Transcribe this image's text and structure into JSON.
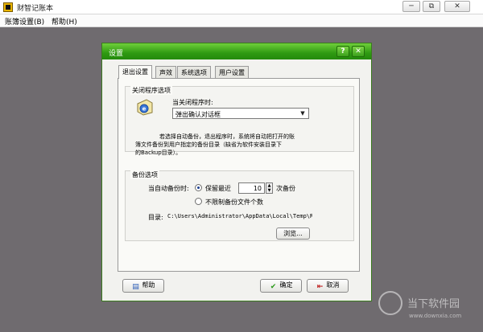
{
  "app": {
    "title": "财智记账本"
  },
  "window_controls": {
    "minimize": "─",
    "restore": "⧉",
    "close": "✕"
  },
  "menu": [
    {
      "label": "账簿设置(B)"
    },
    {
      "label": "帮助(H)"
    }
  ],
  "dialog": {
    "title": "设置",
    "help_icon": "?",
    "close_icon": "✕",
    "tabs": [
      "退出设置",
      "声效",
      "系统选项",
      "用户设置"
    ],
    "close_group": {
      "legend": "关闭程序选项",
      "when_label": "当关闭程序时:",
      "select_value": "弹出确认对话框",
      "desc_line1": "若选择自动备份，退出程序时，系统将自动把打开的账",
      "desc_line2": "簿文件备份到用户指定的备份目录（缺省为软件安装目录下",
      "desc_line3": "的Backup目录）。"
    },
    "backup_group": {
      "legend": "备份选项",
      "when_label": "当自动备份时:",
      "keep_recent_label": "保留最近",
      "keep_count": "10",
      "times_label": "次备份",
      "unlimited_label": "不限制备份文件个数",
      "dir_label": "目录:",
      "dir_value": "C:\\Users\\Administrator\\AppData\\Local\\Temp\\Rar",
      "browse_label": "浏览..."
    },
    "buttons": {
      "help": "帮助",
      "ok": "确定",
      "cancel": "取消"
    }
  },
  "watermark": {
    "text": "当下软件园",
    "url": "www.downxia.com"
  }
}
